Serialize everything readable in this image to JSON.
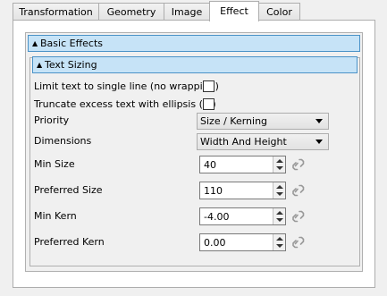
{
  "tabs": [
    "Transformation",
    "Geometry",
    "Image",
    "Effect",
    "Color"
  ],
  "active_tab": "Effect",
  "basic_effects": {
    "title": "Basic Effects",
    "arrow": "▲"
  },
  "text_sizing": {
    "title": "Text Sizing",
    "arrow": "▲",
    "single_line_label": "Limit text to single line (no wrapping)",
    "ellipsis_label": "Truncate excess text with ellipsis (...)",
    "priority_label": "Priority",
    "priority_value": "Size / Kerning",
    "dimensions_label": "Dimensions",
    "dimensions_value": "Width And Height",
    "min_size_label": "Min Size",
    "min_size_value": "40",
    "preferred_size_label": "Preferred Size",
    "preferred_size_value": "110",
    "min_kern_label": "Min Kern",
    "min_kern_value": "-4.00",
    "preferred_kern_label": "Preferred Kern",
    "preferred_kern_value": "0.00"
  },
  "icons": {
    "link": "link-icon"
  },
  "colors": {
    "section_header": "#c6e3f7",
    "section_border": "#4b93c8"
  }
}
